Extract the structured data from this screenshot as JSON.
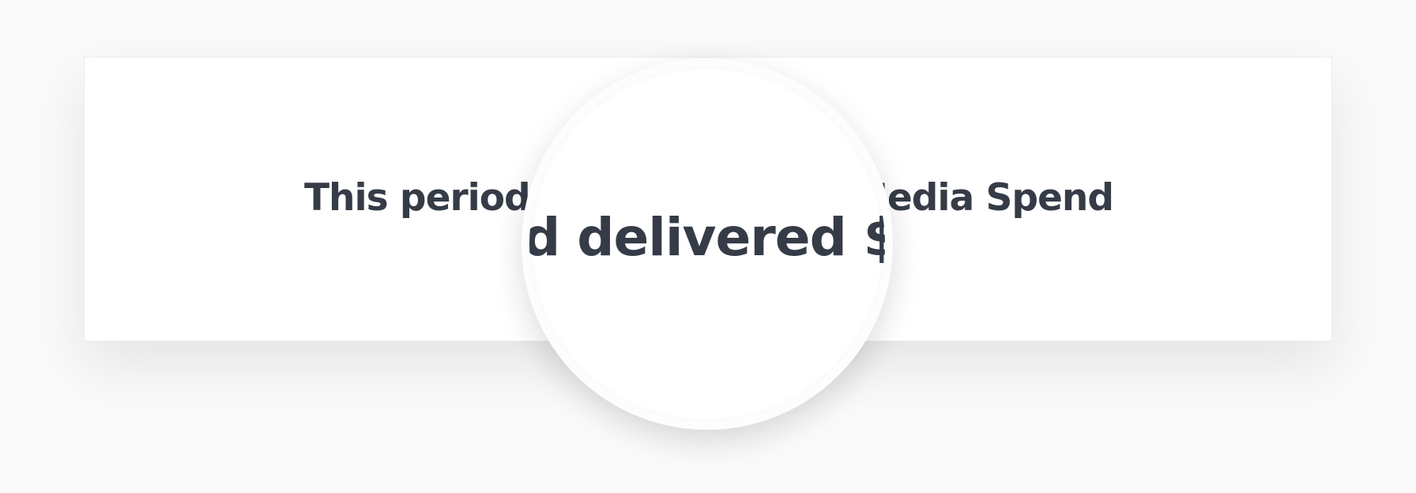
{
  "card": {
    "headline": "This period we delivered $ Media Spend"
  },
  "magnifier": {
    "text": "d delivered $"
  }
}
